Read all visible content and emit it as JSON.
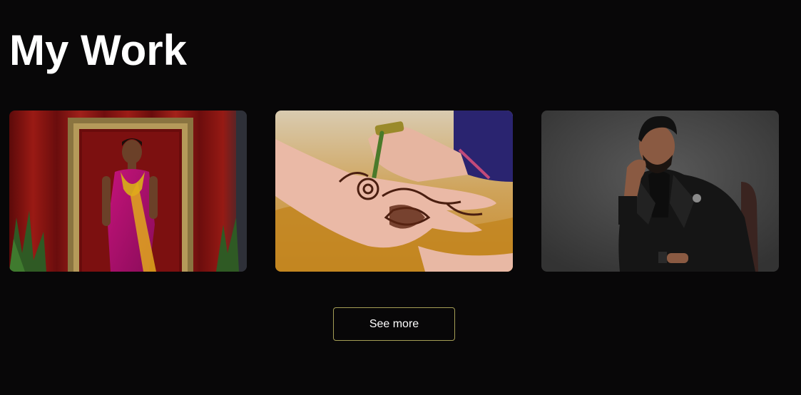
{
  "section": {
    "title": "My Work"
  },
  "gallery": {
    "items": [
      {
        "subject": "bridal-portrait",
        "bg_color": "#7a1010"
      },
      {
        "subject": "henna-hand",
        "bg_color": "#d9c29a"
      },
      {
        "subject": "groom-portrait",
        "bg_color": "#4a4a4a"
      }
    ]
  },
  "actions": {
    "see_more_label": "See more"
  },
  "colors": {
    "background": "#080708",
    "button_border": "#a59e56",
    "text": "#ffffff"
  }
}
